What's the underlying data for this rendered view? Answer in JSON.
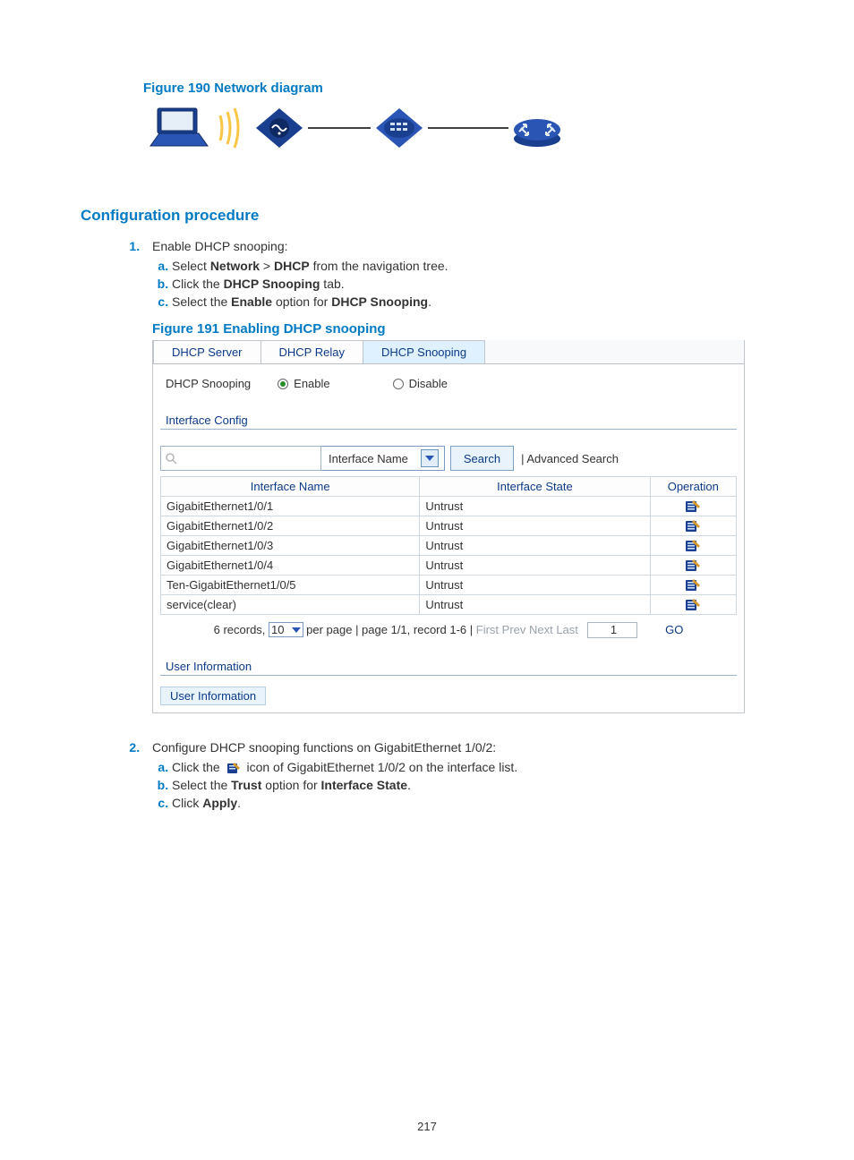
{
  "captions": {
    "fig190": "Figure 190 Network diagram",
    "fig191": "Figure 191 Enabling DHCP snooping"
  },
  "headings": {
    "config_proc": "Configuration procedure"
  },
  "steps": {
    "s1": {
      "text": "Enable DHCP snooping:",
      "a_pre": "Select ",
      "a_network": "Network",
      "a_gt": " > ",
      "a_dhcp": "DHCP",
      "a_post": " from the navigation tree.",
      "b_pre": "Click the ",
      "b_tab": "DHCP Snooping",
      "b_post": " tab.",
      "c_pre": "Select the ",
      "c_enable": "Enable",
      "c_mid": " option for ",
      "c_snoop": "DHCP Snooping",
      "c_post": "."
    },
    "s2": {
      "text": "Configure DHCP snooping functions on GigabitEthernet 1/0/2:",
      "a_pre": "Click the ",
      "a_post": " icon of GigabitEthernet 1/0/2 on the interface list.",
      "b_pre": "Select the ",
      "b_trust": "Trust",
      "b_mid": " option for ",
      "b_istate": "Interface State",
      "b_post": ".",
      "c_pre": "Click ",
      "c_apply": "Apply",
      "c_post": "."
    }
  },
  "gui": {
    "tabs": [
      "DHCP Server",
      "DHCP Relay",
      "DHCP Snooping"
    ],
    "active_tab_index": 2,
    "snooping_label": "DHCP Snooping",
    "radio_enable": "Enable",
    "radio_disable": "Disable",
    "section_interface_config": "Interface Config",
    "search_placeholder": "",
    "search_field": "Interface Name",
    "search_button": "Search",
    "advanced_link": "| Advanced Search",
    "table": {
      "headers": [
        "Interface Name",
        "Interface State",
        "Operation"
      ],
      "rows": [
        {
          "name": "GigabitEthernet1/0/1",
          "state": "Untrust"
        },
        {
          "name": "GigabitEthernet1/0/2",
          "state": "Untrust"
        },
        {
          "name": "GigabitEthernet1/0/3",
          "state": "Untrust"
        },
        {
          "name": "GigabitEthernet1/0/4",
          "state": "Untrust"
        },
        {
          "name": "Ten-GigabitEthernet1/0/5",
          "state": "Untrust"
        },
        {
          "name": "service(clear)",
          "state": "Untrust"
        }
      ]
    },
    "pager": {
      "records_prefix": "6 records,",
      "per_page_value": "10",
      "per_page_suffix": "per page | page 1/1, record 1-6 |",
      "nav": "First  Prev  Next  Last",
      "page_value": "1",
      "go": "GO"
    },
    "user_info_header": "User Information",
    "user_info_chip": "User Information"
  },
  "page_number": "217"
}
